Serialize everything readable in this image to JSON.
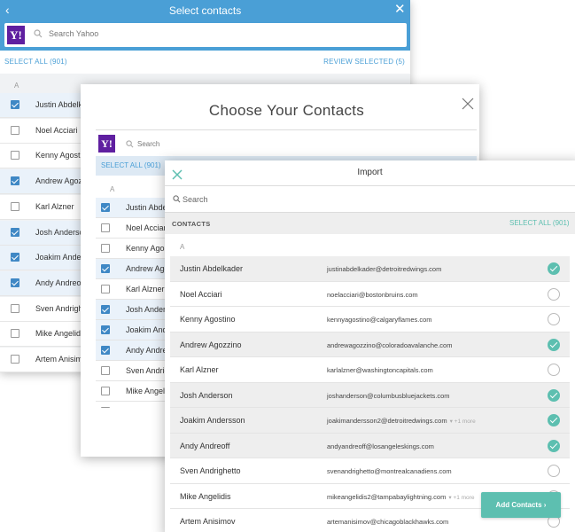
{
  "panel1": {
    "title": "Select contacts",
    "back_glyph": "‹",
    "close_glyph": "✕",
    "search_placeholder": "Search Yahoo",
    "logo": "Y!",
    "select_all": "SELECT ALL (901)",
    "review_selected": "REVIEW SELECTED (5)",
    "letter": "A",
    "contacts": [
      {
        "name": "Justin Abdelkader",
        "checked": true
      },
      {
        "name": "Noel Acciari",
        "checked": false
      },
      {
        "name": "Kenny Agostino",
        "checked": false
      },
      {
        "name": "Andrew Agozzino",
        "checked": true
      },
      {
        "name": "Karl Alzner",
        "checked": false
      },
      {
        "name": "Josh Anderson",
        "checked": true
      },
      {
        "name": "Joakim Andersson",
        "checked": true
      },
      {
        "name": "Andy Andreoff",
        "checked": true
      },
      {
        "name": "Sven Andrighetto",
        "checked": false
      },
      {
        "name": "Mike Angelidis",
        "checked": false
      },
      {
        "name": "Artem Anisimov",
        "checked": false
      }
    ]
  },
  "panel2": {
    "title": "Choose Your Contacts",
    "logo": "Y!",
    "search_placeholder": "Search",
    "select_all": "SELECT ALL (901)",
    "letter": "A",
    "contacts": [
      {
        "name": "Justin Abdelkader",
        "checked": true
      },
      {
        "name": "Noel Acciari",
        "checked": false
      },
      {
        "name": "Kenny Agostino",
        "checked": false
      },
      {
        "name": "Andrew Agozzino",
        "checked": true
      },
      {
        "name": "Karl Alzner",
        "checked": false
      },
      {
        "name": "Josh Anderson",
        "checked": true
      },
      {
        "name": "Joakim Andersson",
        "checked": true
      },
      {
        "name": "Andy Andreoff",
        "checked": true
      },
      {
        "name": "Sven Andrighetto",
        "checked": false
      },
      {
        "name": "Mike Angelidis",
        "checked": false
      },
      {
        "name": "Artem Anisimov",
        "checked": false
      }
    ]
  },
  "panel3": {
    "title": "Import",
    "search_placeholder": "Search",
    "contacts_label": "CONTACTS",
    "select_all": "SELECT ALL (901)",
    "letter": "A",
    "add_button": "Add Contacts ›",
    "accent_color": "#5dbfb0",
    "contacts": [
      {
        "name": "Justin Abdelkader",
        "email": "justinabdelkader@detroitredwings.com",
        "more": "",
        "checked": true
      },
      {
        "name": "Noel Acciari",
        "email": "noelacciari@bostonbruins.com",
        "more": "",
        "checked": false
      },
      {
        "name": "Kenny Agostino",
        "email": "kennyagostino@calgaryflames.com",
        "more": "",
        "checked": false
      },
      {
        "name": "Andrew Agozzino",
        "email": "andrewagozzino@coloradoavalanche.com",
        "more": "",
        "checked": true
      },
      {
        "name": "Karl Alzner",
        "email": "karlalzner@washingtoncapitals.com",
        "more": "",
        "checked": false
      },
      {
        "name": "Josh Anderson",
        "email": "joshanderson@columbusbluejackets.com",
        "more": "",
        "checked": true
      },
      {
        "name": "Joakim Andersson",
        "email": "joakimandersson2@detroitredwings.com",
        "more": "▾ +1 more",
        "checked": true
      },
      {
        "name": "Andy Andreoff",
        "email": "andyandreoff@losangeleskings.com",
        "more": "",
        "checked": true
      },
      {
        "name": "Sven Andrighetto",
        "email": "svenandrighetto@montrealcanadiens.com",
        "more": "",
        "checked": false
      },
      {
        "name": "Mike Angelidis",
        "email": "mikeangelidis2@tampabaylightning.com",
        "more": "▾ +1 more",
        "checked": false
      },
      {
        "name": "Artem Anisimov",
        "email": "artemanisimov@chicagoblackhawks.com",
        "more": "",
        "checked": false
      }
    ]
  }
}
